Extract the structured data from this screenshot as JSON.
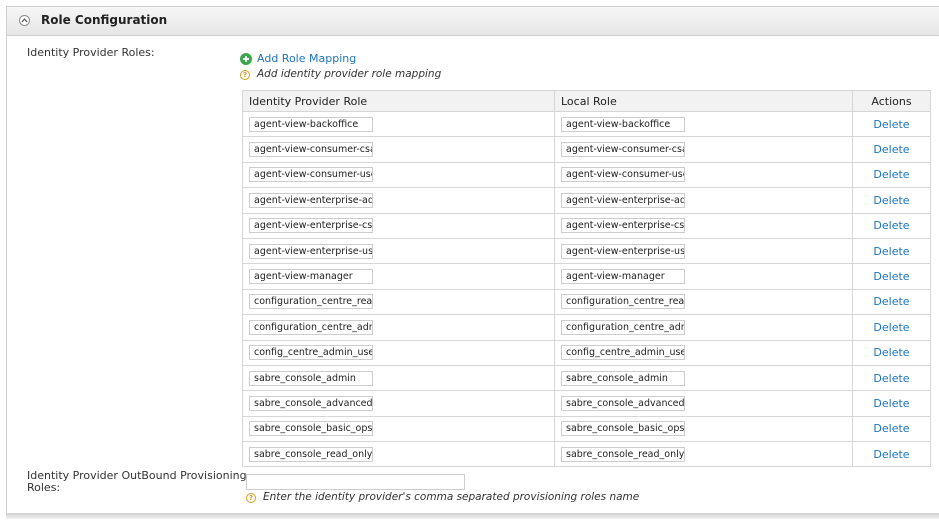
{
  "section": {
    "title": "Role Configuration"
  },
  "idp_roles_label": "Identity Provider Roles:",
  "add_mapping": {
    "link_label": "Add Role Mapping",
    "help_text": "Add identity provider role mapping"
  },
  "table": {
    "headers": [
      "Identity Provider Role",
      "Local Role",
      "Actions"
    ],
    "delete_label": "Delete",
    "rows": [
      {
        "idp": "agent-view-backoffice",
        "local": "agent-view-backoffice"
      },
      {
        "idp": "agent-view-consumer-csa",
        "local": "agent-view-consumer-csa"
      },
      {
        "idp": "agent-view-consumer-user",
        "local": "agent-view-consumer-user"
      },
      {
        "idp": "agent-view-enterprise-admin",
        "local": "agent-view-enterprise-admin"
      },
      {
        "idp": "agent-view-enterprise-csa",
        "local": "agent-view-enterprise-csa"
      },
      {
        "idp": "agent-view-enterprise-user",
        "local": "agent-view-enterprise-user"
      },
      {
        "idp": "agent-view-manager",
        "local": "agent-view-manager"
      },
      {
        "idp": "configuration_centre_read_",
        "local": "configuration_centre_read_"
      },
      {
        "idp": "configuration_centre_admin",
        "local": "configuration_centre_admin"
      },
      {
        "idp": "config_centre_admin_user",
        "local": "config_centre_admin_user"
      },
      {
        "idp": "sabre_console_admin",
        "local": "sabre_console_admin"
      },
      {
        "idp": "sabre_console_advanced_c",
        "local": "sabre_console_advanced_c"
      },
      {
        "idp": "sabre_console_basic_ops",
        "local": "sabre_console_basic_ops"
      },
      {
        "idp": "sabre_console_read_only",
        "local": "sabre_console_read_only"
      }
    ]
  },
  "outbound": {
    "label_line1": "Identity Provider OutBound Provisioning",
    "label_line2": "Roles:",
    "value": "",
    "help_text": "Enter the identity provider's comma separated provisioning roles name"
  },
  "colors": {
    "link": "#1f73b7",
    "add_icon": "#3aa84a",
    "help_icon": "#d39a1e"
  }
}
